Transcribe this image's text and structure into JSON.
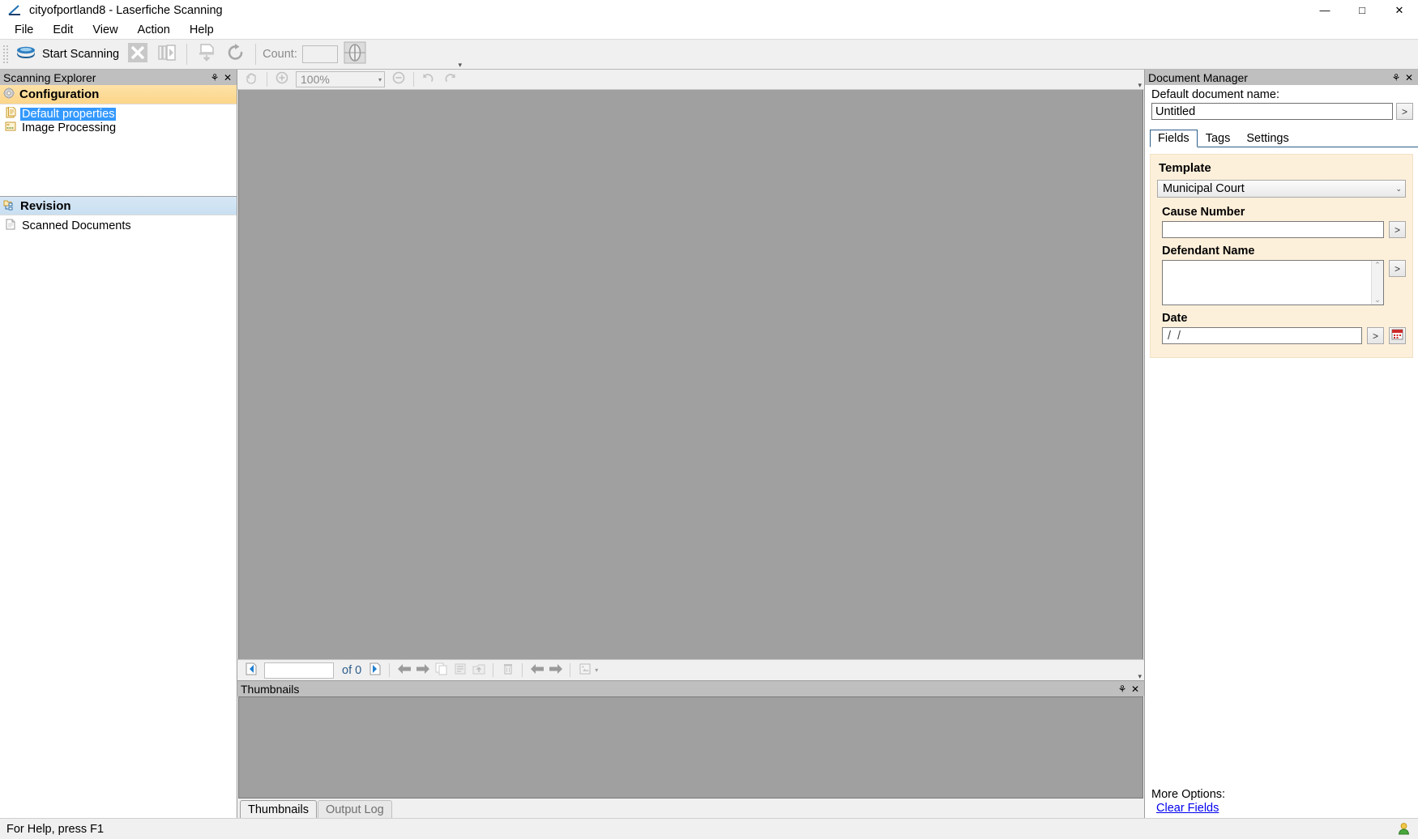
{
  "window": {
    "title": "cityofportland8 - Laserfiche Scanning",
    "app_icon": "scanner-icon",
    "minimize": "—",
    "maximize": "□",
    "close": "✕"
  },
  "menubar": {
    "items": [
      {
        "label": "File"
      },
      {
        "label": "Edit"
      },
      {
        "label": "View"
      },
      {
        "label": "Action"
      },
      {
        "label": "Help"
      }
    ]
  },
  "toolbar": {
    "start_scanning": "Start Scanning",
    "count_label": "Count:",
    "count_value": "",
    "icons": {
      "scanner": "scanner-icon",
      "stop": "stop-scanning-icon",
      "resume": "resume-scanning-icon",
      "insert_page": "insert-page-icon",
      "rescan": "rescan-icon",
      "calibrate": "calibrate-icon"
    },
    "overflow": "▾"
  },
  "scanning_explorer": {
    "caption": "Scanning Explorer",
    "pin": "⚘",
    "close": "✕",
    "groups": [
      {
        "name": "configuration",
        "title": "Configuration",
        "icon": "gear-icon",
        "items": [
          {
            "label": "Default properties",
            "icon": "properties-icon",
            "selected": true
          },
          {
            "label": "Image Processing",
            "icon": "image-processing-icon",
            "selected": false
          }
        ]
      },
      {
        "name": "revision",
        "title": "Revision",
        "icon": "revision-icon",
        "items": [
          {
            "label": "Scanned Documents",
            "icon": "document-icon",
            "selected": false
          }
        ]
      }
    ]
  },
  "viewer": {
    "toolbar": {
      "pan": "pan-hand-icon",
      "zoom_in": "zoom-in-icon",
      "zoom_value": "100%",
      "zoom_arrow": "▾",
      "zoom_out": "zoom-out-icon",
      "undo": "undo-icon",
      "redo": "redo-icon",
      "overflow": "▾"
    },
    "page_nav": {
      "first_page": "first-page-icon",
      "page_value": "",
      "of_text": "of 0",
      "last_page": "last-page-icon",
      "prev": "previous-page-icon",
      "next": "next-page-icon",
      "copy_page": "copy-page-icon",
      "move_page": "move-page-icon",
      "export_page": "export-page-icon",
      "delete_page": "delete-page-icon",
      "rotate_left": "rotate-left-icon",
      "rotate_right": "rotate-right-icon",
      "stamp": "stamp-icon",
      "stamp_arrow": "▾",
      "overflow": "▾"
    }
  },
  "thumbnails_dock": {
    "caption": "Thumbnails",
    "pin": "⚘",
    "close": "✕",
    "tabs": [
      {
        "label": "Thumbnails",
        "active": true
      },
      {
        "label": "Output Log",
        "active": false
      }
    ]
  },
  "document_manager": {
    "caption": "Document Manager",
    "pin": "⚘",
    "close": "✕",
    "default_name_label": "Default document name:",
    "default_name_value": "Untitled",
    "name_browse_button": ">",
    "tabs": [
      {
        "label": "Fields",
        "active": true
      },
      {
        "label": "Tags",
        "active": false
      },
      {
        "label": "Settings",
        "active": false
      }
    ],
    "template_heading": "Template",
    "template_value": "Municipal Court",
    "template_arrow": "⌄",
    "fields": [
      {
        "label": "Cause Number",
        "type": "text",
        "value": "",
        "button": ">"
      },
      {
        "label": "Defendant Name",
        "type": "textarea",
        "value": "",
        "button": ">",
        "scroll_up": "⌃",
        "scroll_down": "⌄"
      },
      {
        "label": "Date",
        "type": "date",
        "value": "/  /",
        "button": ">",
        "calendar_icon": "calendar-icon"
      }
    ],
    "more_options_label": "More Options:",
    "clear_fields_link": "Clear Fields"
  },
  "statusbar": {
    "text": "For Help, press F1",
    "user_icon": "user-status-icon"
  },
  "colors": {
    "config_header": "#fcd589",
    "revision_header": "#c9dff1",
    "selection_blue": "#3399ff",
    "fields_bg": "#fdf0db",
    "canvas_gray": "#a0a0a0",
    "panel_caption": "#bfbfbf",
    "link_blue": "#0000ee"
  }
}
